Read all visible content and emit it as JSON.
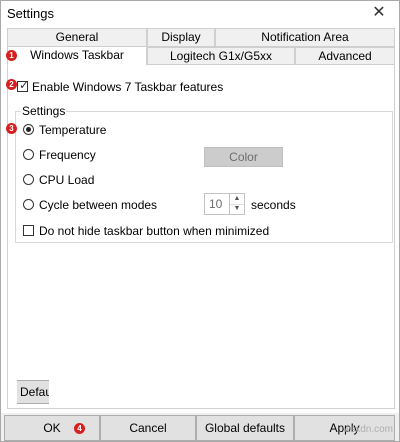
{
  "window": {
    "title": "Settings",
    "close_symbol": "✕"
  },
  "tabs_row1": [
    {
      "label": "General"
    },
    {
      "label": "Display"
    },
    {
      "label": "Notification Area"
    }
  ],
  "tabs_row2": [
    {
      "label": "Windows Taskbar",
      "active": true
    },
    {
      "label": "Logitech G1x/G5xx"
    },
    {
      "label": "Advanced"
    }
  ],
  "badges": {
    "tab": "1",
    "enable": "2",
    "settings": "3",
    "ok": "4"
  },
  "enable_checkbox": {
    "label": "Enable Windows 7 Taskbar features",
    "checked": true
  },
  "settings_group": {
    "label": "Settings",
    "options": [
      {
        "label": "Temperature",
        "selected": true
      },
      {
        "label": "Frequency",
        "selected": false
      },
      {
        "label": "CPU Load",
        "selected": false
      },
      {
        "label": "Cycle between modes",
        "selected": false
      }
    ],
    "color_button": "Color",
    "cycle_seconds": "10",
    "seconds_label": "seconds",
    "hide_checkbox": {
      "label": "Do not hide taskbar button when minimized",
      "checked": false
    }
  },
  "default_button": "Default",
  "buttons": {
    "ok": "OK",
    "cancel": "Cancel",
    "global": "Global defaults",
    "apply": "Apply"
  },
  "watermark": "wsxdn.com",
  "colors": {
    "badge": "#d62020",
    "button_bg": "#e1e1e1"
  }
}
